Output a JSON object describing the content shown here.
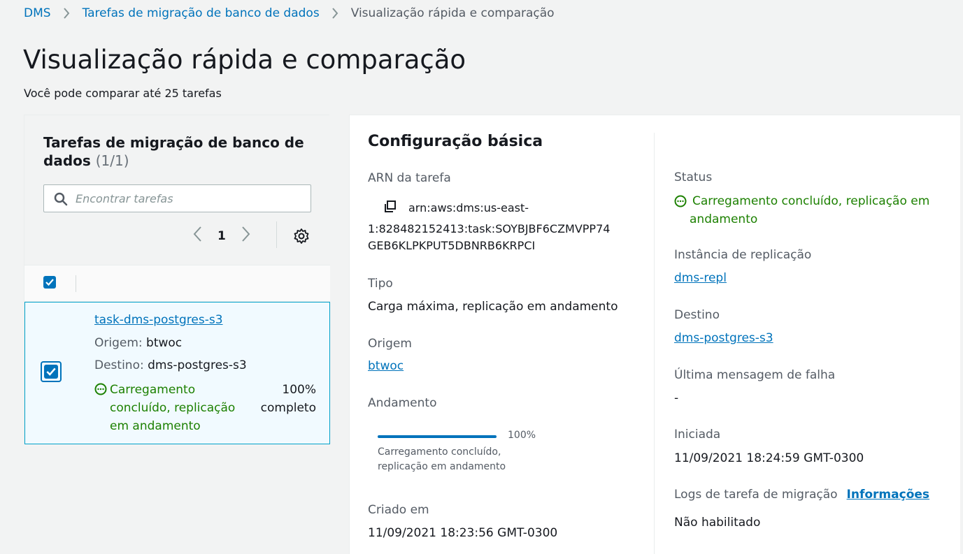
{
  "breadcrumb": {
    "items": [
      "DMS",
      "Tarefas de migração de banco de dados"
    ],
    "current": "Visualização rápida e comparação"
  },
  "page": {
    "title": "Visualização rápida e comparação",
    "description": "Você pode comparar até 25 tarefas"
  },
  "left_panel": {
    "title": "Tarefas de migração de banco de dados",
    "count": "(1/1)",
    "search_placeholder": "Encontrar tarefas",
    "page_number": "1",
    "task": {
      "name": "task-dms-postgres-s3",
      "origin_label": "Origem:",
      "origin_value": "btwoc",
      "target_label": "Destino:",
      "target_value": "dms-postgres-s3",
      "status_lines": [
        "Carregamento",
        "concluído, replicação",
        "em andamento"
      ],
      "progress_lines": [
        "100%",
        "completo"
      ]
    }
  },
  "details": {
    "title": "Configuração básica",
    "arn_label": "ARN da tarefa",
    "arn_first": "arn:aws:dms:us-east-",
    "arn_rest_1": "1:828482152413:task:SOYBJBF6CZMVPP74",
    "arn_rest_2": "GEB6KLPKPUT5DBNRB6KRPCI",
    "type_label": "Tipo",
    "type_value": "Carga máxima, replicação em andamento",
    "origin_label": "Origem",
    "origin_value": "btwoc",
    "progress_label": "Andamento",
    "progress_percent": "100%",
    "progress_value": 1.0,
    "progress_desc_1": "Carregamento concluído,",
    "progress_desc_2": "replicação em andamento",
    "created_label": "Criado em",
    "created_value": "11/09/2021 18:23:56 GMT-0300",
    "status_label": "Status",
    "status_line_1": "Carregamento concluído, replicação em",
    "status_line_2": "andamento",
    "instance_label": "Instância de replicação",
    "instance_value": "dms-repl",
    "target_label": "Destino",
    "target_value": "dms-postgres-s3",
    "last_failure_label": "Última mensagem de falha",
    "last_failure_value": "-",
    "started_label": "Iniciada",
    "started_value": "11/09/2021 18:24:59 GMT-0300",
    "logs_label": "Logs de tarefa de migração",
    "logs_info": "Informações",
    "logs_value": "Não habilitado"
  },
  "colors": {
    "link": "#0073bb",
    "success": "#1d8102",
    "selected_bg": "#f1faff",
    "selected_border": "#00a1c9"
  },
  "icons": [
    "chevron-right-icon",
    "search-icon",
    "chevron-left-icon",
    "gear-icon",
    "checkbox-checked-icon",
    "in-progress-icon",
    "copy-icon"
  ]
}
